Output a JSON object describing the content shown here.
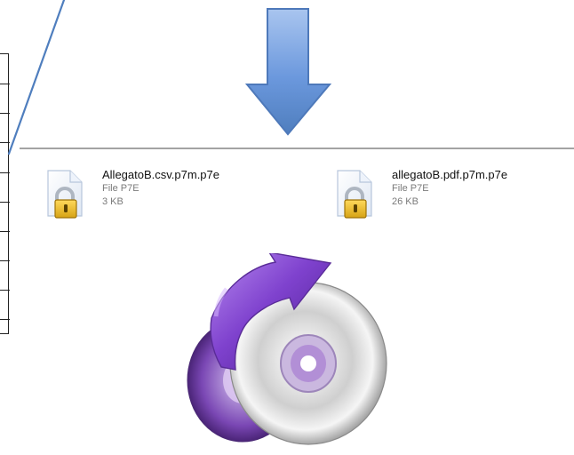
{
  "files": [
    {
      "name": "AllegatoB.csv.p7m.p7e",
      "type": "File P7E",
      "size": "3 KB",
      "icon": "locked-document-icon"
    },
    {
      "name": "allegatoB.pdf.p7m.p7e",
      "type": "File P7E",
      "size": "26 KB",
      "icon": "locked-document-icon"
    }
  ],
  "colors": {
    "arrow_blue": "#5b86c9",
    "line_blue": "#4f7ebe",
    "separator": "#a3a3a3",
    "disc_purple": "#7a47b4",
    "disc_silver": "#d9d9d9"
  },
  "icons": {
    "arrow": "down-arrow-icon",
    "disc": "disc-conversion-icon"
  }
}
